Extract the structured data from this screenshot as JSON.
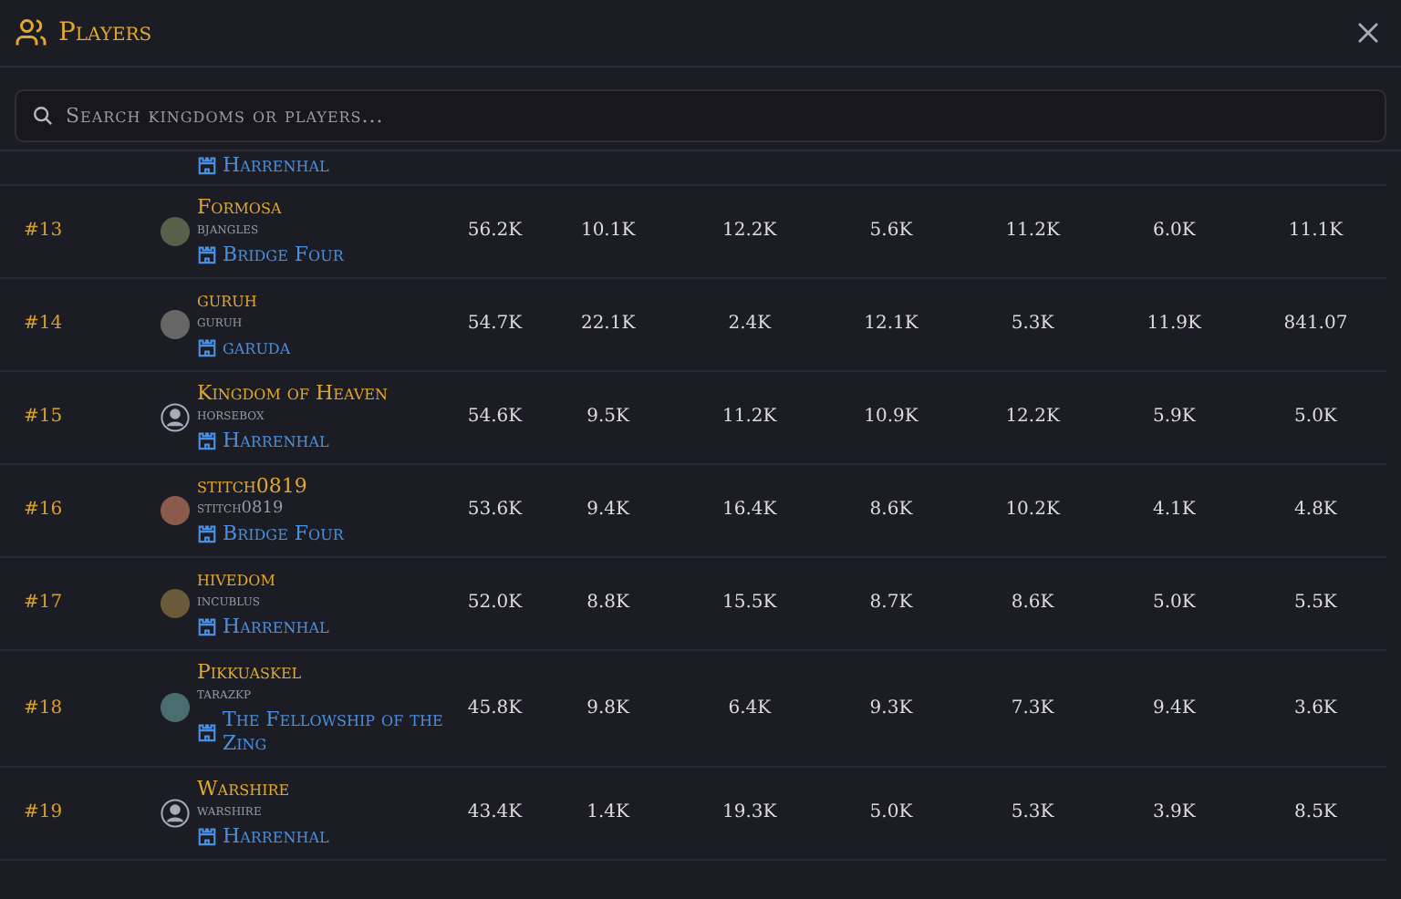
{
  "header": {
    "title": "Players"
  },
  "search": {
    "placeholder": "Search kingdoms or players..."
  },
  "rows": [
    {
      "kingdom": "Harrenhal"
    },
    {
      "rank": "#13",
      "name": "Formosa",
      "user": "bjangles",
      "kingdom": "Bridge Four",
      "kind": "photo",
      "stats": [
        "56.2K",
        "10.1K",
        "12.2K",
        "5.6K",
        "11.2K",
        "6.0K",
        "11.1K"
      ]
    },
    {
      "rank": "#14",
      "name": "guruh",
      "user": "guruh",
      "kingdom": "garuda",
      "kind": "photo",
      "stats": [
        "54.7K",
        "22.1K",
        "2.4K",
        "12.1K",
        "5.3K",
        "11.9K",
        "841.07"
      ]
    },
    {
      "rank": "#15",
      "name": "Kingdom of Heaven",
      "user": "horsebox",
      "kingdom": "Harrenhal",
      "kind": "default",
      "stats": [
        "54.6K",
        "9.5K",
        "11.2K",
        "10.9K",
        "12.2K",
        "5.9K",
        "5.0K"
      ]
    },
    {
      "rank": "#16",
      "name": "stitch0819",
      "user": "stitch0819",
      "kingdom": "Bridge Four",
      "kind": "photo",
      "stats": [
        "53.6K",
        "9.4K",
        "16.4K",
        "8.6K",
        "10.2K",
        "4.1K",
        "4.8K"
      ]
    },
    {
      "rank": "#17",
      "name": "hivedom",
      "user": "incublus",
      "kingdom": "Harrenhal",
      "kind": "photo",
      "stats": [
        "52.0K",
        "8.8K",
        "15.5K",
        "8.7K",
        "8.6K",
        "5.0K",
        "5.5K"
      ]
    },
    {
      "rank": "#18",
      "name": "Pikkuaskel",
      "user": "tarazkp",
      "kingdom": "The Fellowship of the Zing",
      "kind": "photo",
      "stats": [
        "45.8K",
        "9.8K",
        "6.4K",
        "9.3K",
        "7.3K",
        "9.4K",
        "3.6K"
      ]
    },
    {
      "rank": "#19",
      "name": "Warshire",
      "user": "warshire",
      "kingdom": "Harrenhal",
      "kind": "default",
      "stats": [
        "43.4K",
        "1.4K",
        "19.3K",
        "5.0K",
        "5.3K",
        "3.9K",
        "8.5K"
      ]
    }
  ]
}
